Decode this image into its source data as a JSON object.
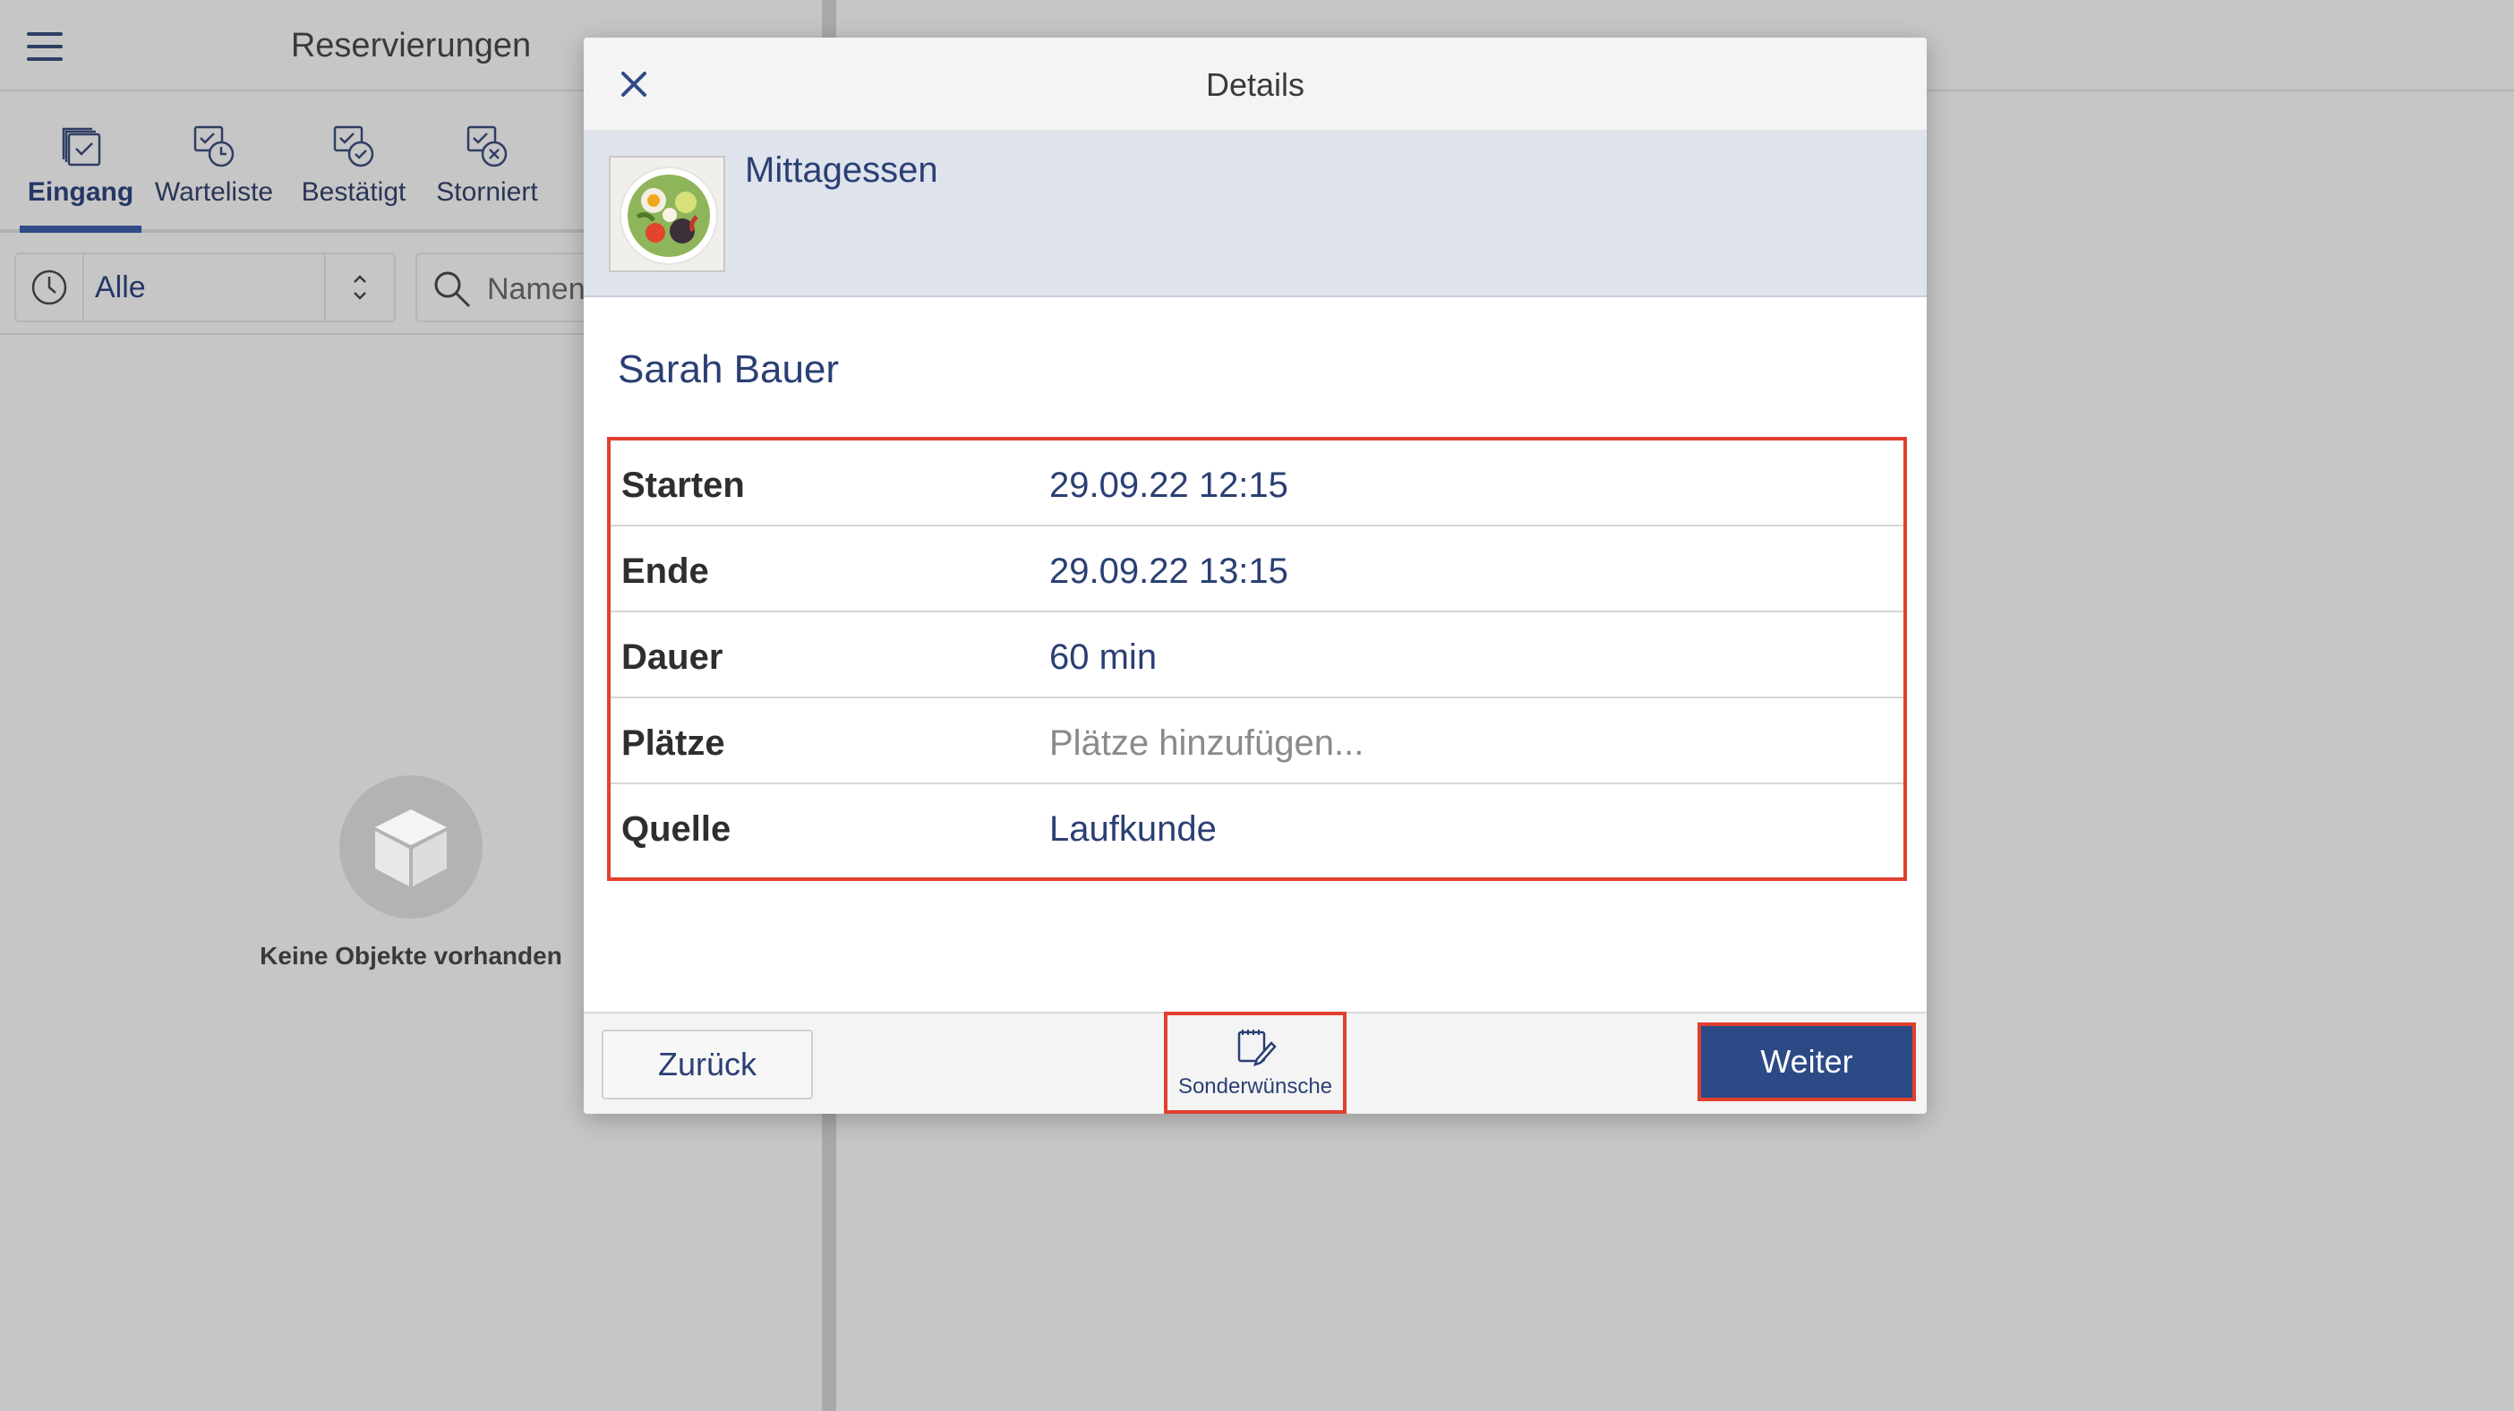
{
  "app": {
    "title": "Reservierungen",
    "tabs": [
      {
        "label": "Eingang",
        "icon": "inbox-stack-icon",
        "active": true
      },
      {
        "label": "Warteliste",
        "icon": "waitlist-clock-icon",
        "active": false
      },
      {
        "label": "Bestätigt",
        "icon": "confirmed-check-icon",
        "active": false
      },
      {
        "label": "Storniert",
        "icon": "cancelled-x-icon",
        "active": false
      }
    ],
    "filter": {
      "value": "Alle"
    },
    "search": {
      "placeholder": "Namen"
    },
    "empty_state": {
      "text": "Keine Objekte vorhanden"
    }
  },
  "modal": {
    "title": "Details",
    "event": {
      "name": "Mittagessen",
      "image": "salad-bowl-thumbnail"
    },
    "guest_name": "Sarah Bauer",
    "fields": [
      {
        "label": "Starten",
        "value": "29.09.22 12:15",
        "placeholder": false
      },
      {
        "label": "Ende",
        "value": "29.09.22 13:15",
        "placeholder": false
      },
      {
        "label": "Dauer",
        "value": "60 min",
        "placeholder": false
      },
      {
        "label": "Plätze",
        "value": "Plätze hinzufügen...",
        "placeholder": true
      },
      {
        "label": "Quelle",
        "value": "Laufkunde",
        "placeholder": false
      }
    ],
    "footer": {
      "back_label": "Zurück",
      "special_label": "Sonderwünsche",
      "next_label": "Weiter"
    }
  },
  "colors": {
    "accent": "#2c4a86",
    "highlight": "#e0402e",
    "text_primary": "#2a3f73",
    "backdrop": "#c6c6c6"
  }
}
